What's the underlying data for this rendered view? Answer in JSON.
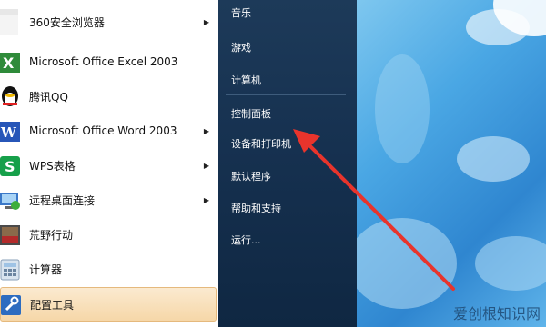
{
  "programs": [
    {
      "label": "360安全浏览器",
      "icon": "browser-360-icon",
      "submenu": true
    },
    {
      "label": "Microsoft Office Excel 2003",
      "icon": "excel-icon",
      "submenu": false
    },
    {
      "label": "腾讯QQ",
      "icon": "qq-penguin-icon",
      "submenu": false
    },
    {
      "label": "Microsoft Office Word 2003",
      "icon": "word-icon",
      "submenu": true
    },
    {
      "label": "WPS表格",
      "icon": "wps-sheet-icon",
      "submenu": true
    },
    {
      "label": "远程桌面连接",
      "icon": "remote-desktop-icon",
      "submenu": true
    },
    {
      "label": "荒野行动",
      "icon": "game-icon",
      "submenu": false
    },
    {
      "label": "计算器",
      "icon": "calculator-icon",
      "submenu": false
    },
    {
      "label": "配置工具",
      "icon": "wrench-icon",
      "submenu": false,
      "highlighted": true
    }
  ],
  "places": {
    "music": "音乐",
    "games": "游戏",
    "computer": "计算机",
    "control_panel": "控制面板",
    "devices_printers": "设备和打印机",
    "default_programs": "默认程序",
    "help_support": "帮助和支持",
    "run": "运行..."
  },
  "watermark": "爱创根知识网",
  "colors": {
    "highlight": "#f6d7a8",
    "pane": "#163150",
    "arrow": "#e8342c"
  }
}
